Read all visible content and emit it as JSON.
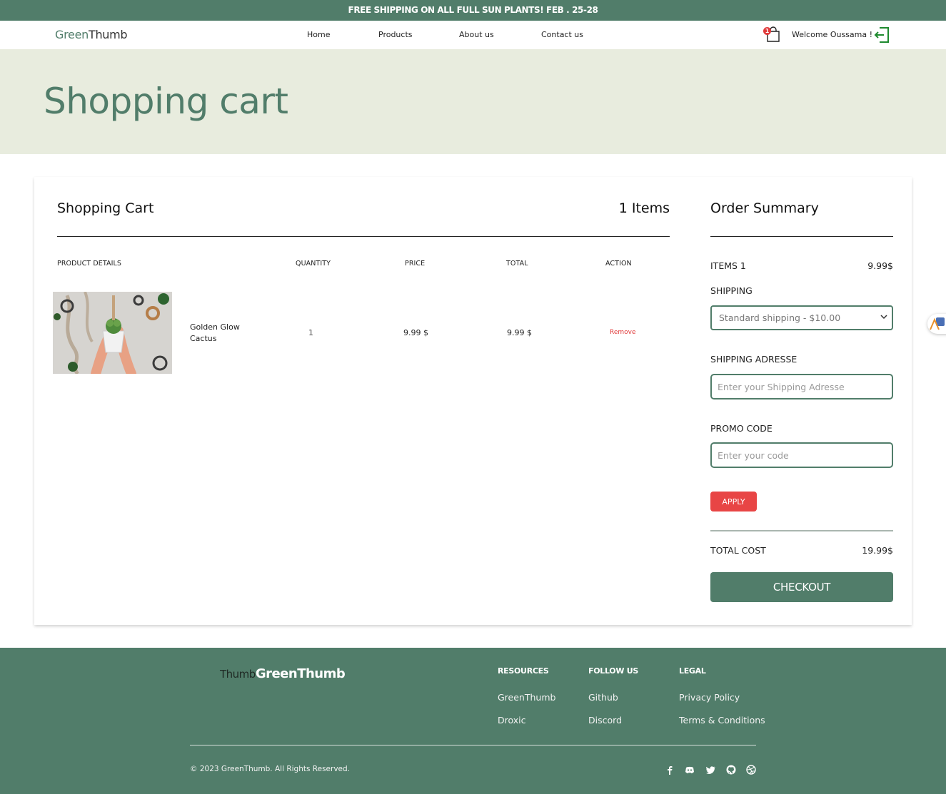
{
  "announcement": "FREE SHIPPING ON ALL FULL SUN PLANTS! FEB . 25-28",
  "nav": {
    "brand_green": "Green",
    "brand_thumb": "Thumb",
    "links": [
      "Home",
      "Products",
      "About us",
      "Contact us"
    ],
    "cart_count": "1",
    "welcome": "Welcome Oussama !"
  },
  "hero": {
    "title": "Shopping cart"
  },
  "cart": {
    "title": "Shopping Cart",
    "items_count": "1 Items",
    "headers": [
      "PRODUCT DETAILS",
      "QUANTITY",
      "PRICE",
      "TOTAL",
      "ACTION"
    ],
    "rows": [
      {
        "name": "Golden Glow Cactus",
        "quantity": "1",
        "price": "9.99 $",
        "total": "9.99 $",
        "action": "Remove"
      }
    ]
  },
  "summary": {
    "title": "Order Summary",
    "items_label": "ITEMS 1",
    "items_value": "9.99$",
    "shipping_label": "SHIPPING",
    "shipping_selected": "Standard shipping - $10.00",
    "address_label": "SHIPPING ADRESSE",
    "address_placeholder": "Enter your Shipping Adresse",
    "promo_label": "PROMO CODE",
    "promo_placeholder": "Enter your code",
    "apply_label": "APPLY",
    "total_label": "TOTAL COST",
    "total_value": "19.99$",
    "checkout_label": "CHECKOUT"
  },
  "footer": {
    "logo_thumb": "Thumb",
    "logo_main": "GreenThumb",
    "columns": [
      {
        "heading": "RESOURCES",
        "links": [
          "GreenThumb",
          "Droxic"
        ]
      },
      {
        "heading": "FOLLOW US",
        "links": [
          "Github",
          "Discord"
        ]
      },
      {
        "heading": "LEGAL",
        "links": [
          "Privacy Policy",
          "Terms & Conditions"
        ]
      }
    ],
    "copyright": "© 2023 GreenThumb. All Rights Reserved.",
    "social_icons": [
      "facebook-icon",
      "discord-icon",
      "twitter-icon",
      "github-icon",
      "dribbble-icon"
    ]
  },
  "colors": {
    "brand": "#517d6a",
    "hero_bg": "#e8ecde",
    "danger": "#e84545"
  }
}
